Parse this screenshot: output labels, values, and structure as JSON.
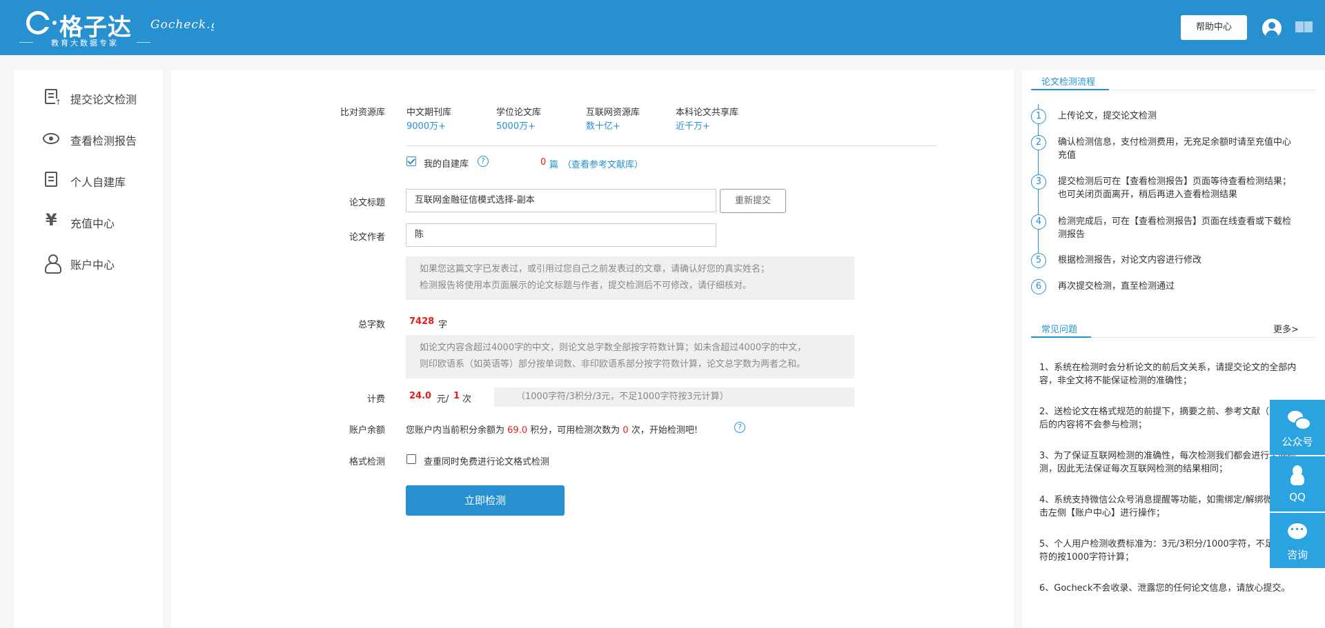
{
  "header": {
    "brand_name": "格子达",
    "brand_sub": "教育大数据专家",
    "brand_script": "Gocheck.g",
    "help_label": "帮助中心"
  },
  "sidebar": {
    "items": [
      {
        "label": "提交论文检测",
        "icon": "doc-upload-icon"
      },
      {
        "label": "查看检测报告",
        "icon": "eye-icon"
      },
      {
        "label": "个人自建库",
        "icon": "list-doc-icon"
      },
      {
        "label": "充值中心",
        "icon": "yen-icon"
      },
      {
        "label": "账户中心",
        "icon": "person-icon"
      }
    ]
  },
  "form": {
    "sources_label": "比对资源库",
    "sources": [
      {
        "name": "中文期刊库",
        "value": "9000万+"
      },
      {
        "name": "学位论文库",
        "value": "5000万+"
      },
      {
        "name": "互联网资源库",
        "value": "数十亿+"
      },
      {
        "name": "本科论文共享库",
        "value": "近千万+"
      }
    ],
    "own_library_label": "我的自建库",
    "own_library_count": "0",
    "own_library_unit": "篇",
    "own_library_link": "（查看参考文献库）",
    "title_label": "论文标题",
    "title_value": "互联网金融征信模式选择-副本",
    "resubmit_label": "重新提交",
    "author_label": "论文作者",
    "author_value": "陈",
    "author_note_1": "如果您这篇文字已发表过，或引用过您自己之前发表过的文章，请确认好您的真实姓名；",
    "author_note_2": "检测报告将使用本页面展示的论文标题与作者，提交检测后不可修改，请仔细核对。",
    "wordcount_label": "总字数",
    "wordcount_value": "7428",
    "wordcount_unit": "字",
    "wordcount_note_1": "如论文内容含超过4000字的中文，则论文总字数全部按字符数计算；如未含超过4000字的中文，",
    "wordcount_note_2": "则印欧语系（如英语等）部分按单词数、非印欧语系部分按字符数计算，论文总字数为两者之和。",
    "fee_label": "计费",
    "fee_value": "24.0",
    "fee_unit": "元/",
    "fee_times": "1",
    "fee_times_unit": "次",
    "fee_note": "（1000字符/3积分/3元，不足1000字符按3元计算）",
    "balance_label": "账户余额",
    "balance_pre": "您账户内当前积分余额为",
    "balance_points": "69.0",
    "balance_mid": "积分，可用检测次数为",
    "balance_count": "0",
    "balance_post": "次，开始检测吧!",
    "format_label": "格式检测",
    "format_option": "查重同时免费进行论文格式检测",
    "submit_label": "立即检测"
  },
  "right": {
    "process_title": "论文检测流程",
    "steps": [
      {
        "num": "1",
        "text": "上传论文，提交论文检测"
      },
      {
        "num": "2",
        "text": "确认检测信息，支付检测费用，无充足余额时请至充值中心充值"
      },
      {
        "num": "3",
        "text": "提交检测后可在【查看检测报告】页面等待查看检测结果；也可关闭页面离开，稍后再进入查看检测结果"
      },
      {
        "num": "4",
        "text": "检测完成后，可在【查看检测报告】页面在线查看或下载检测报告"
      },
      {
        "num": "5",
        "text": "根据检测报告，对论文内容进行修改"
      },
      {
        "num": "6",
        "text": "再次提交检测，直至检测通过"
      }
    ],
    "faq_title": "常见问题",
    "more_label": "更多>",
    "faqs": [
      "1、系统在检测时会分析论文的前后文关系，请提交论文的全部内容，非全文将不能保证检测的准确性；",
      "2、送检论文在格式规范的前提下，摘要之前、参考文献（含）及之后的内容将不会参与检测；",
      "3、为了保证互联网检测的准确性，每次检测我们都会进行全网检测，因此无法保证每次互联网检测的结果相同；",
      "4、系统支持微信公众号消息提醒等功能，如需绑定/解绑微信，请点击左侧【账户中心】进行操作；",
      "5、个人用户检测收费标准为：3元/3积分/1000字符，不足1000字符的按1000字符计算；",
      "6、Gocheck不会收录、泄露您的任何论文信息，请放心提交。"
    ]
  },
  "float": {
    "wechat_label": "公众号",
    "qq_label": "QQ",
    "consult_label": "咨询"
  }
}
